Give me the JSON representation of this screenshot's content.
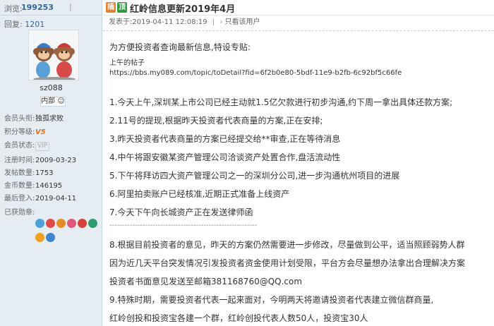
{
  "stats": {
    "views_label": "浏览:",
    "views_value": "199253",
    "separator": "|",
    "reply_label": "回复:",
    "reply_value": "1201"
  },
  "thread": {
    "badge_a": "插",
    "badge_b": "顶",
    "title": "红岭信息更新2019年4月"
  },
  "post_meta": {
    "posted_at": "发表于:2019-04-11 12:08:19",
    "separator": "|",
    "only_author": "只看该用户"
  },
  "user": {
    "name": "sz088",
    "inner_button": "内部",
    "rows": [
      {
        "k": "会员头衔:",
        "v": "独孤求败"
      },
      {
        "k": "积分等级:",
        "v": "V5"
      },
      {
        "k": "会员状态:",
        "v": "VIP"
      },
      {
        "k": "注册时间:",
        "v": "2009-03-23"
      },
      {
        "k": "发帖数量:",
        "v": "1753"
      },
      {
        "k": "金币数量:",
        "v": "146195"
      },
      {
        "k": "最后登入:",
        "v": "2019-04-11"
      },
      {
        "k": "已获勋章:",
        "v": ""
      }
    ],
    "medal_colors": [
      "#4da1d9",
      "#e24a4a",
      "#e58b2a",
      "#e0557a",
      "#d6403a",
      "#2f9a6b",
      "#f0a020",
      "#3f86d0"
    ]
  },
  "post": {
    "intro": "为方便投资者查询最新信息,特设专贴:",
    "morning_label": "上午的帖子",
    "url": "https://bbs.my089.com/topic/toDetail?fid=6f2b0e80-5bdf-11e9-b2fb-6c92bf5c66fe",
    "items": [
      "1.今天上午,深圳某上市公司已经主动就1.5亿欠款进行初步沟通,约下周一拿出具体还款方案;",
      "2.11号的提现,根据昨天投资者代表商量的方案,正在安排;",
      "3.昨天投资者代表商量的方案已经提交给**审查,正在等待消息",
      "4.中午将跟安徽某资产管理公司洽谈资产处置合作,盘活流动性",
      "5.下午将拜访四大资产管理公司之一的深圳分公司,进一步沟通杭州项目的进展",
      "6.阿里拍卖账户已经核准,近期正式准备上线资产",
      "7.今天下午向长城资产正在发送律师函"
    ],
    "divider_text": "----------------------------------------------------------",
    "item8_lines": [
      "8.根据目前投资者的意见，昨天的方案仍然需要进一步修改，尽量做到公平，适当照顾弱势人群",
      "因为近几天平台突发情况引发投资者资金使用计划受限，平台方会尽量想办法拿出合理解决方案",
      "投资者书面意见发送至邮箱381168760@QQ.com"
    ],
    "item9_lines": [
      "9.特殊时期，需要投资者代表一起来面对，今明两天将邀请投资者代表建立微信群商量,",
      "红岭创投和投资宝各建一个群，红岭创投代表人数50人，投资宝30人"
    ]
  }
}
